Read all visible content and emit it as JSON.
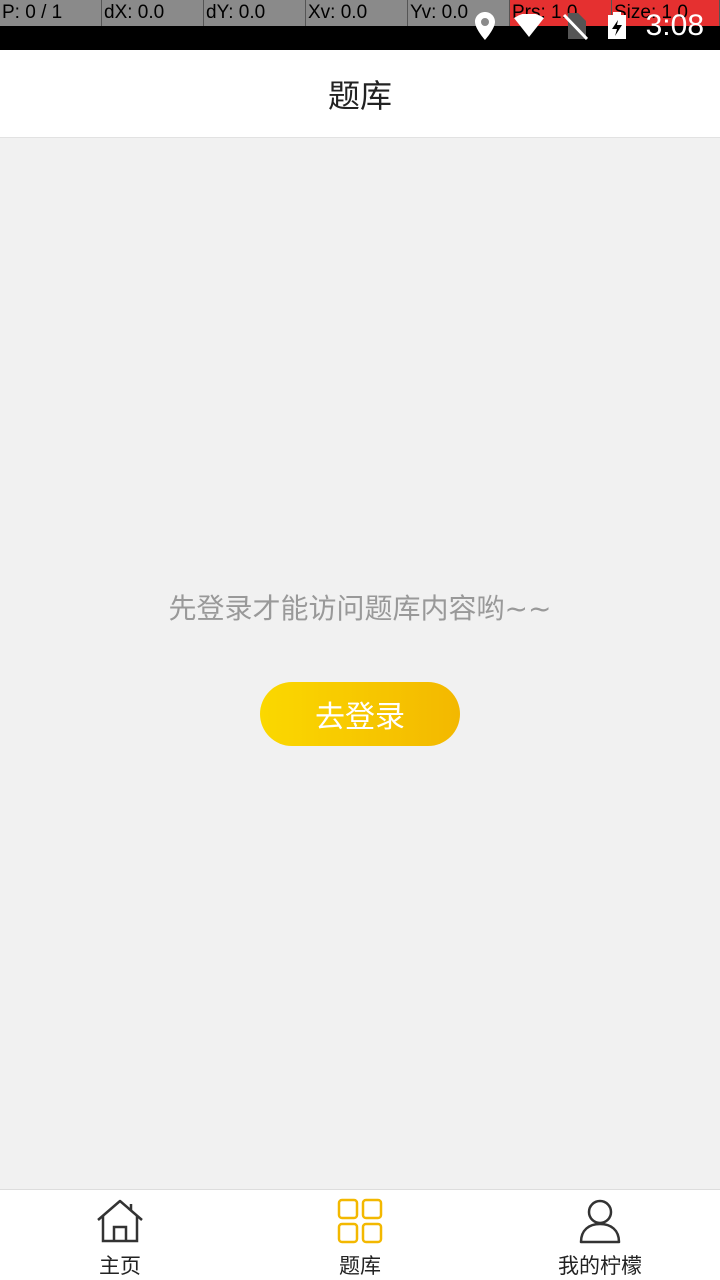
{
  "status_bar": {
    "debug": [
      "P: 0 / 1",
      "dX: 0.0",
      "dY: 0.0",
      "Xv: 0.0",
      "Yv: 0.0",
      "Prs: 1.0",
      "Size: 1.0"
    ],
    "time": "3:08",
    "icons": [
      "location-icon",
      "wifi-icon",
      "no-sim-icon",
      "battery-charging-icon"
    ]
  },
  "header": {
    "title": "题库"
  },
  "main": {
    "prompt": "先登录才能访问题库内容哟~~",
    "login_button": "去登录",
    "accent_start": "#fbd800",
    "accent_end": "#f3b800"
  },
  "tabbar": {
    "tabs": [
      {
        "label": "主页",
        "icon": "home-icon",
        "active": false
      },
      {
        "label": "题库",
        "icon": "grid-icon",
        "active": true
      },
      {
        "label": "我的柠檬",
        "icon": "user-icon",
        "active": false
      }
    ],
    "active_color": "#f3b800"
  }
}
